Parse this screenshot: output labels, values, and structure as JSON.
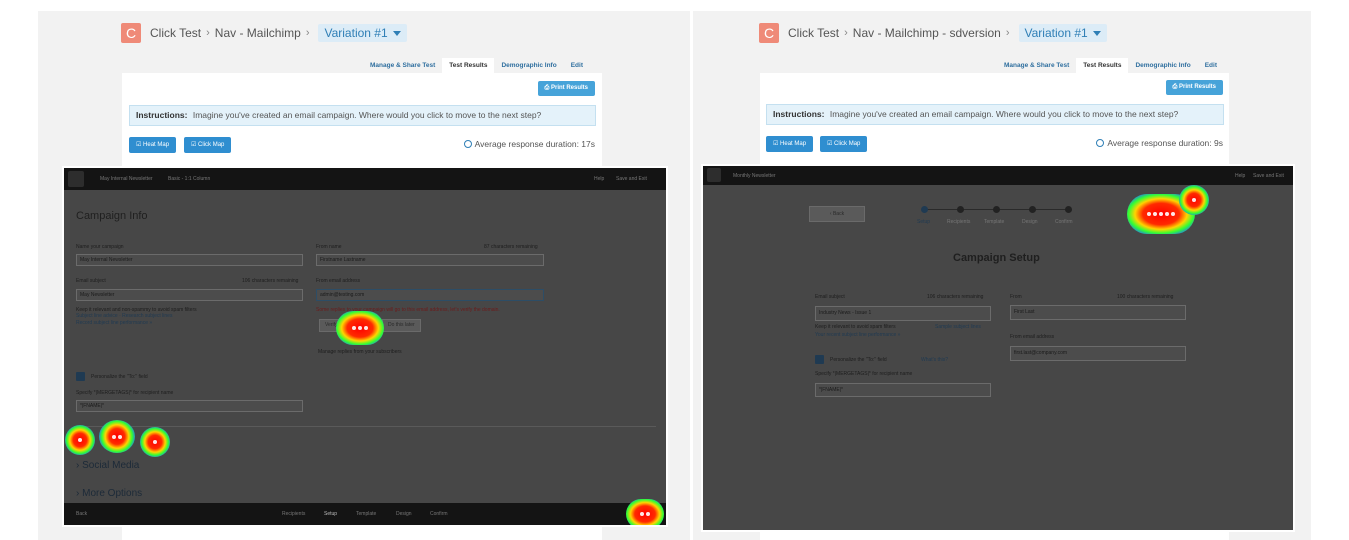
{
  "left": {
    "logo_letter": "C",
    "breadcrumb": [
      "Click Test",
      "Nav - Mailchimp"
    ],
    "variation": "Variation #1",
    "tabs": [
      "Manage & Share Test",
      "Test Results",
      "Demographic Info",
      "Edit"
    ],
    "active_tab": "Test Results",
    "print_label": "Print Results",
    "instructions_label": "Instructions:",
    "instructions_text": "Imagine you've created an email campaign. Where would you click to move to the next step?",
    "heatmap_label": "Heat Map",
    "clickmap_label": "Click Map",
    "duration": "Average response duration: 17s",
    "shot": {
      "topbar_title": "May Internal Newsletter",
      "topbar_sub": "Basic - 1:1 Column",
      "topbar_right": [
        "Help",
        "Save and Exit"
      ],
      "heading": "Campaign Info",
      "name_label": "Name your campaign",
      "name_value": "May Internal Newsletter",
      "from_name_label": "From name",
      "from_name_note": "87 characters remaining",
      "from_name_value": "Firstname Lastname",
      "subject_label": "Email subject",
      "subject_note": "106 characters remaining",
      "subject_value": "May Newsletter",
      "from_email_label": "From email address",
      "from_email_value": "admin@testing.com",
      "subject_hint": "Keep it relevant and non-spammy to avoid spam filters",
      "subject_links": "Subject line advice · Research subject lines",
      "subject_perf": "Record subject line performance »",
      "error_text": "Some replies to your campaign will go to this email address, let's verify the domain.",
      "verify_btn": "Verify",
      "later_btn": "Do this later",
      "manage_replies": "Manage replies from your subscribers",
      "personalize": "Personalize the \"To:\" field",
      "merge_hint": "Specify *|MERGETAGS|* for recipient name",
      "merge_value": "*|FNAME|*",
      "social": "› Social Media",
      "more": "› More Options",
      "back": "Back",
      "footer_steps": [
        "Recipients",
        "Setup",
        "Template",
        "Design",
        "Confirm"
      ]
    }
  },
  "right": {
    "logo_letter": "C",
    "breadcrumb": [
      "Click Test",
      "Nav - Mailchimp - sdversion"
    ],
    "variation": "Variation #1",
    "tabs": [
      "Manage & Share Test",
      "Test Results",
      "Demographic Info",
      "Edit"
    ],
    "active_tab": "Test Results",
    "print_label": "Print Results",
    "instructions_label": "Instructions:",
    "instructions_text": "Imagine you've created an email campaign. Where would you click to move to the next step?",
    "heatmap_label": "Heat Map",
    "clickmap_label": "Click Map",
    "duration": "Average response duration: 9s",
    "shot": {
      "topbar_title": "Monthly Newsletter",
      "topbar_right": [
        "Help",
        "Save and Exit"
      ],
      "back_btn": "‹ Back",
      "steps": [
        "Setup",
        "Recipients",
        "Template",
        "Design",
        "Confirm"
      ],
      "heading": "Campaign Setup",
      "subject_label": "Email subject",
      "subject_note": "106 characters remaining",
      "subject_value": "Industry News - Issue 1",
      "from_label": "From",
      "from_note": "100 characters remaining",
      "from_value": "First Last",
      "subject_hint": "Keep it relevant to avoid spam filters",
      "subject_link": "Sample subject lines",
      "subject_perf": "Your recent subject line performance »",
      "from_email_label": "From email address",
      "from_email_value": "first.last@company.com",
      "personalize": "Personalize the \"To:\" field",
      "whats_this": "What's this?",
      "merge_hint": "Specify *|MERGETAGS|* for recipient name",
      "merge_value": "*|FNAME|*"
    }
  },
  "colors": {
    "logo": "#ef8a78",
    "accent": "#2f8ed0",
    "instructions_bg": "#e4f2fa"
  }
}
